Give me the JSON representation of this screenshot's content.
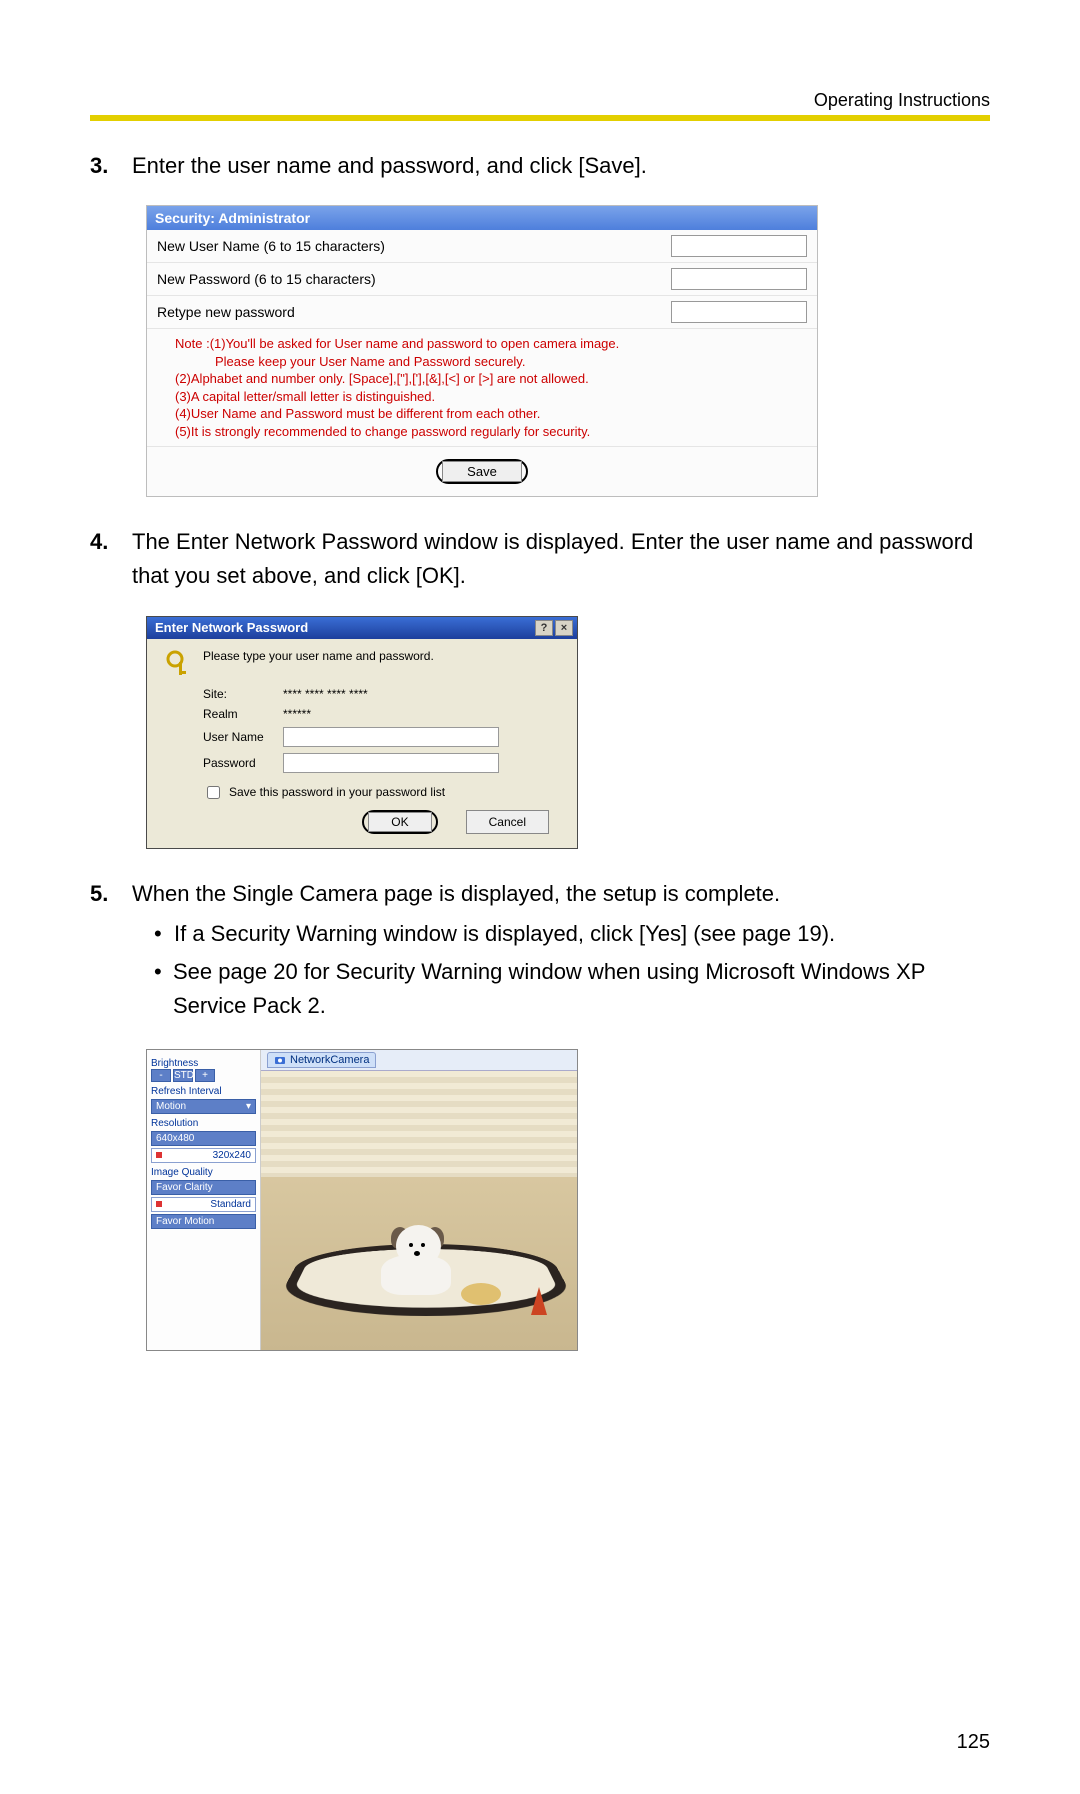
{
  "header": "Operating Instructions",
  "steps": {
    "s3": {
      "num": "3.",
      "text": "Enter the user name and password, and click [Save]."
    },
    "s4": {
      "num": "4.",
      "text": "The Enter Network Password window is displayed. Enter the user name and password that you set above, and click [OK]."
    },
    "s5": {
      "num": "5.",
      "text": "When the Single Camera page is displayed, the setup is complete.",
      "b1": "If a Security Warning window is displayed, click [Yes] (see page 19).",
      "b2": "See page 20 for Security Warning window when using Microsoft Windows XP Service Pack 2."
    }
  },
  "security_panel": {
    "title": "Security: Administrator",
    "row1": "New User Name (6 to 15 characters)",
    "row2": "New Password (6 to 15 characters)",
    "row3": "Retype new password",
    "note_lead": "Note :",
    "n1": "(1)You'll be asked for User name and password to open camera image.",
    "n1b": "Please keep your User Name and Password securely.",
    "n2": "(2)Alphabet and number only. [Space],[\"],['],[&],[<] or [>] are not allowed.",
    "n3": "(3)A capital letter/small letter is distinguished.",
    "n4": "(4)User Name and Password must be different from each other.",
    "n5": "(5)It is strongly recommended to change password regularly for security.",
    "save": "Save"
  },
  "dialog": {
    "title": "Enter Network Password",
    "help": "?",
    "close": "×",
    "prompt": "Please type your user name and password.",
    "site_lbl": "Site:",
    "site_val": "**** **** **** ****",
    "realm_lbl": "Realm",
    "realm_val": "******",
    "user_lbl": "User Name",
    "pass_lbl": "Password",
    "chk": "Save this password in your password list",
    "ok": "OK",
    "cancel": "Cancel"
  },
  "camera": {
    "tab": "NetworkCamera",
    "brightness": "Brightness",
    "std": "STD",
    "refresh": "Refresh Interval",
    "motion": "Motion",
    "resolution": "Resolution",
    "r1": "640x480",
    "r2": "320x240",
    "quality": "Image Quality",
    "q1": "Favor Clarity",
    "q2": "Standard",
    "q3": "Favor Motion"
  },
  "page_number": "125"
}
